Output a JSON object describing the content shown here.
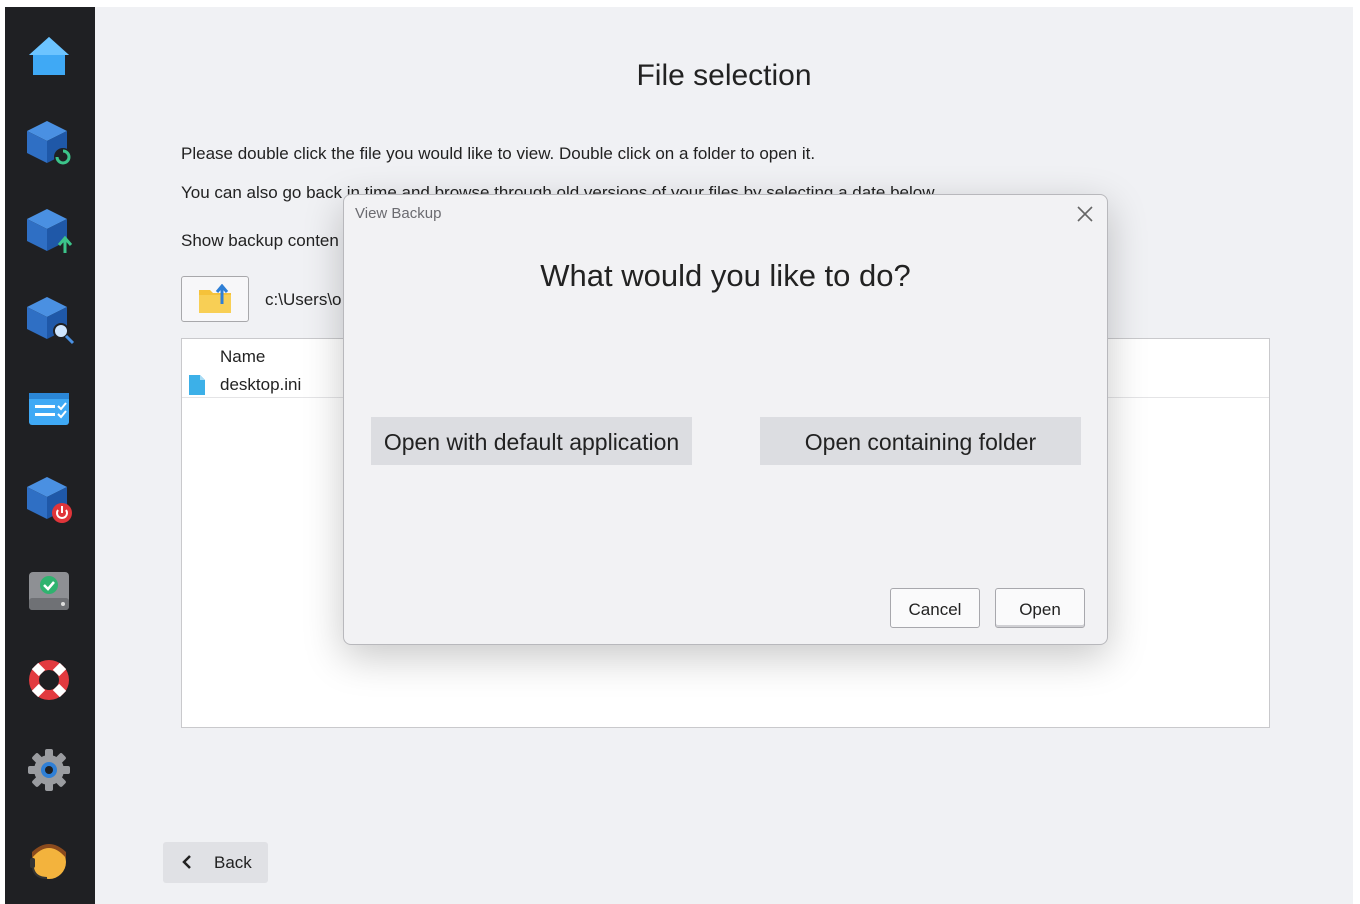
{
  "sidebar": {
    "items": [
      {
        "icon": "home-icon"
      },
      {
        "icon": "backup-restore-icon"
      },
      {
        "icon": "backup-upload-icon"
      },
      {
        "icon": "backup-search-icon"
      },
      {
        "icon": "task-list-icon"
      },
      {
        "icon": "backup-power-icon"
      },
      {
        "icon": "drive-check-icon"
      },
      {
        "icon": "lifebuoy-help-icon"
      },
      {
        "icon": "gear-icon"
      },
      {
        "icon": "support-agent-icon"
      }
    ]
  },
  "main": {
    "title": "File selection",
    "instruction_1": "Please double click the file you would like to view. Double click on a folder to open it.",
    "instruction_2": "You can also go back in time and browse through old versions of your files by selecting a date below.",
    "show_label": "Show backup conten",
    "path": "c:\\Users\\o",
    "filelist": {
      "column_name": "Name",
      "files": [
        {
          "name": "desktop.ini"
        }
      ]
    },
    "back_label": "Back"
  },
  "dialog": {
    "title": "View Backup",
    "question": "What would you like to do?",
    "option_default_app": "Open with default application",
    "option_containing_folder": "Open containing folder",
    "cancel_label": "Cancel",
    "open_label": "Open"
  },
  "colors": {
    "sidebar_bg": "#1f2023",
    "main_bg": "#f0f1f4",
    "accent_blue": "#2f7fd6",
    "dialog_bg": "#f2f2f4"
  }
}
